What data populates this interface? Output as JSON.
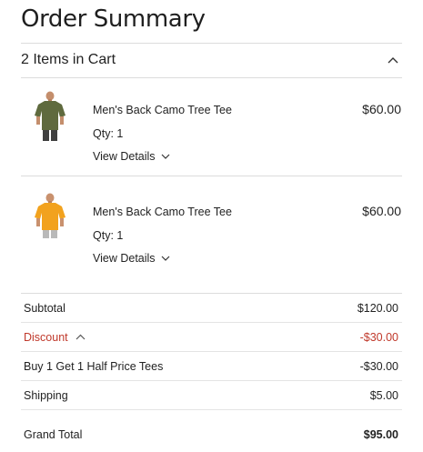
{
  "header": {
    "title": "Order Summary"
  },
  "cart": {
    "label": "2 Items in Cart",
    "items": [
      {
        "name": "Men's Back Camo Tree Tee",
        "qty": "Qty: 1",
        "details_label": "View Details",
        "price": "$60.00",
        "shirt_color": "#5f6a3e"
      },
      {
        "name": "Men's Back Camo Tree Tee",
        "qty": "Qty: 1",
        "details_label": "View Details",
        "price": "$60.00",
        "shirt_color": "#f2a21e"
      }
    ]
  },
  "summary": {
    "subtotal_label": "Subtotal",
    "subtotal_value": "$120.00",
    "discount_label": "Discount",
    "discount_value": "-$30.00",
    "promo_label": "Buy 1 Get 1 Half Price Tees",
    "promo_value": "-$30.00",
    "shipping_label": "Shipping",
    "shipping_value": "$5.00",
    "total_label": "Grand Total",
    "total_value": "$95.00"
  },
  "colors": {
    "discount": "#c0392b",
    "divider": "#dcdcdc"
  }
}
